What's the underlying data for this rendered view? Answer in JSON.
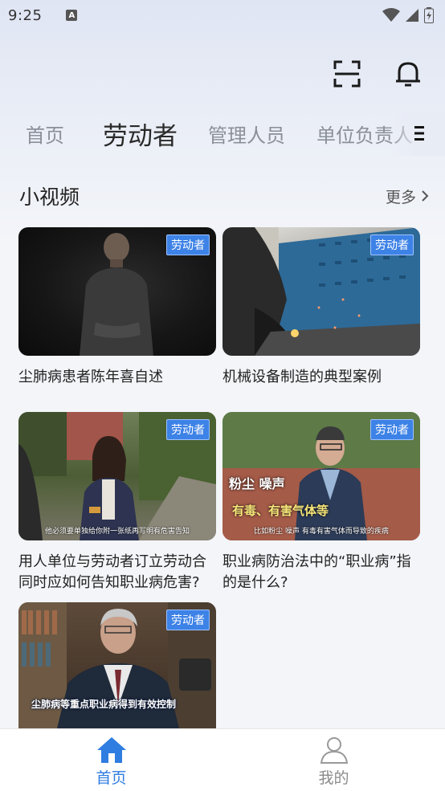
{
  "status_bar": {
    "time": "9:25",
    "notice_glyph": "A"
  },
  "tabs": [
    {
      "label": "首页",
      "active": false
    },
    {
      "label": "劳动者",
      "active": true
    },
    {
      "label": "管理人员",
      "active": false
    },
    {
      "label": "单位负责人",
      "active": false
    }
  ],
  "section": {
    "title": "小视频",
    "more": "更多"
  },
  "videos": [
    {
      "title": "尘肺病患者陈年喜自述",
      "badge": "劳动者",
      "subtitle": ""
    },
    {
      "title": "机械设备制造的典型案例",
      "badge": "劳动者",
      "subtitle": ""
    },
    {
      "title": "用人单位与劳动者订立劳动合同时应如何告知职业病危害?",
      "badge": "劳动者",
      "subtitle": "他必须要单独给你附一张纸再写明有危害告知"
    },
    {
      "title": "职业病防治法中的“职业病”指的是什么?",
      "badge": "劳动者",
      "subtitle": "比如粉尘 噪声 有毒有害气体而导致的疾病",
      "overlay1": "粉尘  噪声",
      "overlay2": "有毒、有害气体等"
    },
    {
      "title": "",
      "badge": "劳动者",
      "subtitle": "尘肺病等重点职业病得到有效控制"
    }
  ],
  "bottom_nav": [
    {
      "label": "首页",
      "icon": "home-icon",
      "active": true
    },
    {
      "label": "我的",
      "icon": "user-icon",
      "active": false
    }
  ],
  "colors": {
    "accent": "#2f7de0",
    "badge": "#3d82e6"
  }
}
